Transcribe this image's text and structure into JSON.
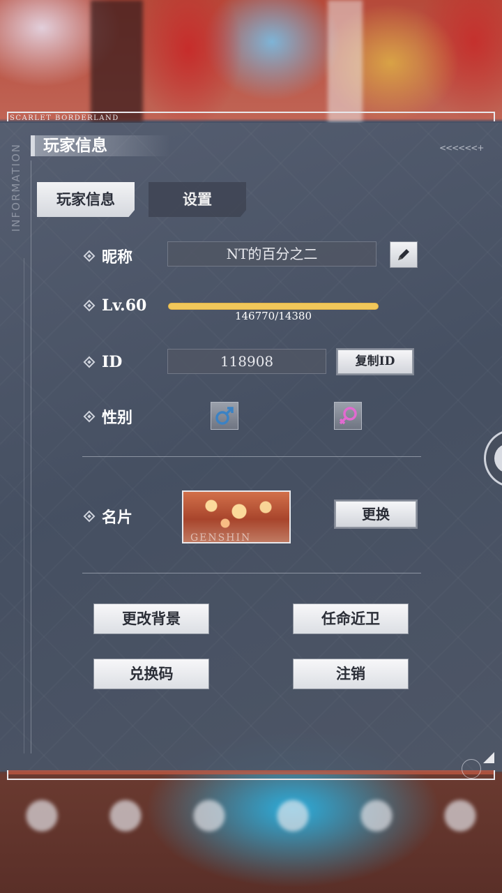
{
  "brand": "SCARLET BORDERLAND",
  "side_label": "INFORMATION",
  "section_title": "玩家信息",
  "decor_chevrons": "<<<<<<+",
  "tabs": [
    {
      "label": "玩家信息",
      "active": true
    },
    {
      "label": "设置",
      "active": false
    }
  ],
  "nickname": {
    "label": "昵称",
    "value": "NT的百分之二",
    "edit_icon": "pencil-icon"
  },
  "level": {
    "label": "Lv.60",
    "exp_text": "146770/14380",
    "exp_fill": 1.0,
    "bar_color": "#f1c75a"
  },
  "id": {
    "label": "ID",
    "value": "118908",
    "copy_label": "复制ID"
  },
  "gender": {
    "label": "性别",
    "male_icon": "male-symbol-icon",
    "female_icon": "female-symbol-icon",
    "male_color": "#3b82c4",
    "female_color": "#e26ad0"
  },
  "card": {
    "label": "名片",
    "thumb_text": "GENSHIN",
    "change_label": "更换"
  },
  "actions": {
    "change_background": "更改背景",
    "appoint_guard": "任命近卫",
    "redeem_code": "兑换码",
    "logout": "注销"
  }
}
